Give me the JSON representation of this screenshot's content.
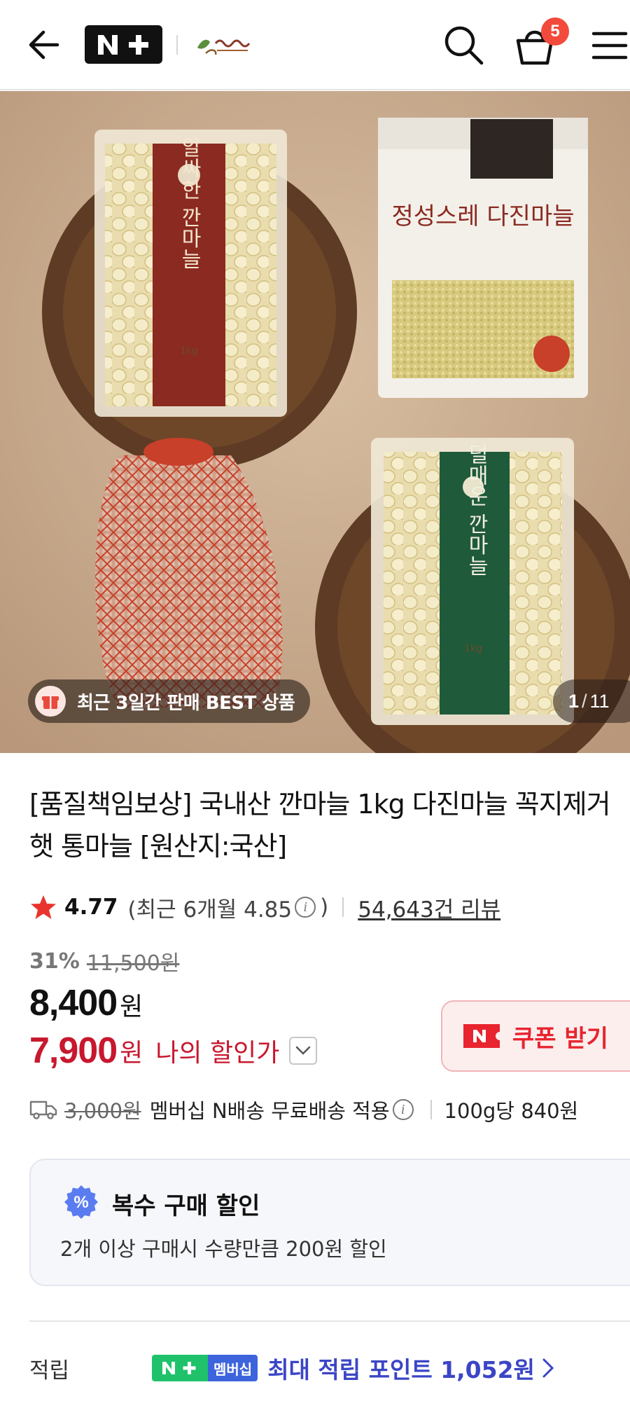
{
  "header": {
    "back_icon": "arrow-left-icon",
    "logo_text": "N+",
    "brand_logo_text": "",
    "cart_count": "5",
    "icons": [
      "search-icon",
      "cart-icon",
      "menu-icon"
    ]
  },
  "hero": {
    "badge_text": "최근 3일간 판매 BEST 상품",
    "counter_current": "1",
    "counter_total": "11",
    "package_labels": {
      "red": "알싸한 깐마늘",
      "white_title": "정성스레 다진마늘",
      "green": "덜매운 깐마늘",
      "weight": "1kg"
    }
  },
  "product": {
    "title": "[품질책임보상] 국내산 깐마늘 1kg 다진마늘 꼭지제거 햇 통마늘 [원산지:국산]",
    "rating": "4.77",
    "recent_rating": "(최근 6개월 4.85",
    "recent_rating_close": ")",
    "review_count": "54,643건 리뷰",
    "discount_pct": "31%",
    "original_price": "11,500원",
    "price_number": "8,400",
    "price_unit": "원",
    "my_price_number": "7,900",
    "my_price_unit": "원",
    "my_price_label": "나의 할인가",
    "coupon_label": "쿠폰 받기"
  },
  "delivery": {
    "fee": "3,000원",
    "text": "멤버십 N배송 무료배송 적용",
    "unit_price": "100g당 840원"
  },
  "multi_discount": {
    "title": "복수 구매 할인",
    "description": "2개 이상 구매시 수량만큼 200원 할인"
  },
  "points": {
    "label": "적립",
    "badge_member": "멤버십",
    "text": "최대 적립 포인트 1,052원"
  },
  "colors": {
    "accent_red": "#c8182e",
    "coupon_red": "#e8242f",
    "badge_red": "#f24a3c",
    "points_blue": "#3b45c6",
    "nplus_green": "#1fc26b",
    "member_blue": "#3e64dd"
  }
}
